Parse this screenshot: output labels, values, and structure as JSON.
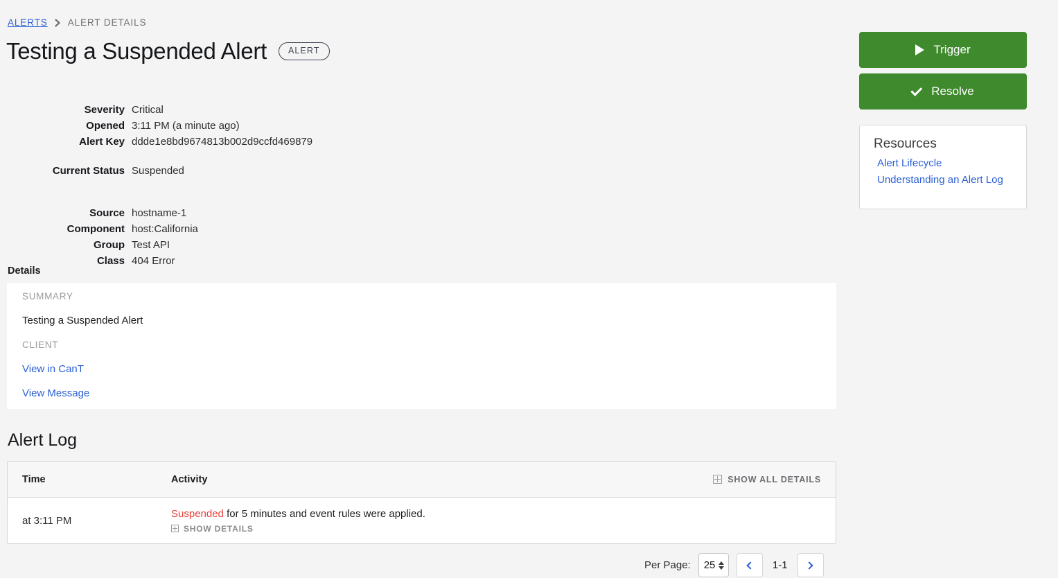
{
  "breadcrumb": {
    "root_label": "ALERTS",
    "separator_icon": "chevron-right-icon",
    "current_label": "ALERT DETAILS"
  },
  "header": {
    "title": "Testing a Suspended Alert",
    "badge": "ALERT"
  },
  "meta": {
    "severity_label": "Severity",
    "severity_value": "Critical",
    "opened_label": "Opened",
    "opened_value": "3:11 PM (a minute ago)",
    "alert_key_label": "Alert Key",
    "alert_key_value": "ddde1e8bd9674813b002d9ccfd469879",
    "current_status_label": "Current Status",
    "current_status_value": "Suspended",
    "source_label": "Source",
    "source_value": "hostname-1",
    "component_label": "Component",
    "component_value": "host:California",
    "group_label": "Group",
    "group_value": "Test API",
    "class_label": "Class",
    "class_value": "404 Error"
  },
  "details": {
    "heading": "Details",
    "summary_label": "SUMMARY",
    "summary_value": "Testing a Suspended Alert",
    "client_label": "CLIENT",
    "client_link_1": "View in CanT",
    "client_link_2": "View Message"
  },
  "alert_log": {
    "heading": "Alert Log",
    "columns": [
      "Time",
      "Activity"
    ],
    "show_all_details_label": "SHOW ALL DETAILS",
    "show_all_details_icon": "expand-plus-icon",
    "rows": [
      {
        "time": "at 3:11 PM",
        "activity_status": "Suspended",
        "activity_text": " for 5 minutes and event rules were applied.",
        "show_details_label": "SHOW DETAILS",
        "show_details_icon": "expand-plus-icon"
      }
    ]
  },
  "pagination": {
    "per_page_label": "Per Page:",
    "per_page_value": "25",
    "per_page_options": [
      "25"
    ],
    "prev_icon": "chevron-left-icon",
    "next_icon": "chevron-right-icon",
    "range": "1-1"
  },
  "actions": {
    "trigger_label": "Trigger",
    "trigger_icon": "play-icon",
    "resolve_label": "Resolve",
    "resolve_icon": "check-icon"
  },
  "resources": {
    "title": "Resources",
    "links": [
      "Alert Lifecycle",
      "Understanding an Alert Log"
    ]
  },
  "colors": {
    "accent_green": "#3f8a2d",
    "link_blue": "#2a5fd4",
    "status_red": "#e8413c",
    "page_background": "#f4f4f5"
  }
}
